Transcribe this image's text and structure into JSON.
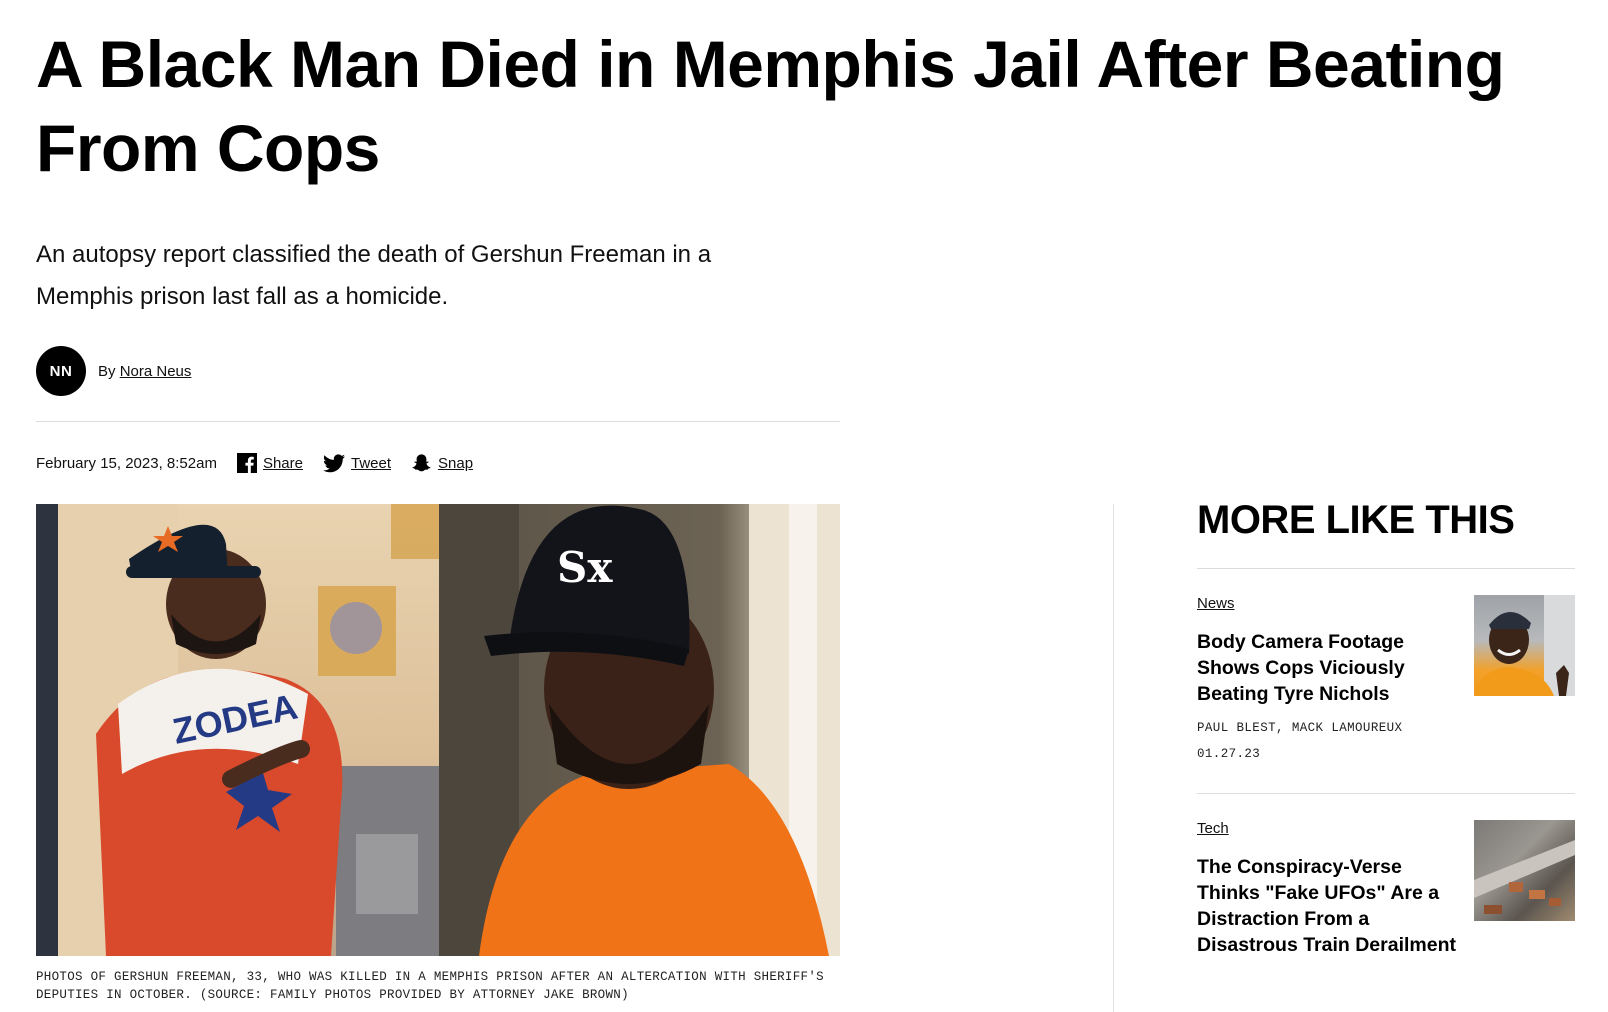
{
  "article": {
    "headline": "A Black Man Died in Memphis Jail After Beating From Cops",
    "dek": "An autopsy report classified the death of Gershun Freeman in a Memphis prison last fall as a homicide.",
    "byline": {
      "initials": "NN",
      "prefix": "By",
      "author": "Nora Neus"
    },
    "date": "February 15, 2023, 8:52am",
    "share": {
      "facebook_label": "Share",
      "twitter_label": "Tweet",
      "snapchat_label": "Snap"
    },
    "caption": "PHOTOS OF GERSHUN FREEMAN, 33, WHO WAS KILLED IN A MEMPHIS PRISON AFTER AN ALTERCATION WITH SHERIFF'S DEPUTIES IN OCTOBER. (SOURCE: FAMILY PHOTOS PROVIDED BY ATTORNEY JAKE BROWN)"
  },
  "more_like_this": {
    "title": "More like this",
    "stories": [
      {
        "category": "News",
        "title": "Body Camera Footage Shows Cops Viciously Beating Tyre Nichols",
        "authors": "PAUL BLEST, MACK LAMOUREUX",
        "date": "01.27.23"
      },
      {
        "category": "Tech",
        "title": "The Conspiracy-Verse Thinks \"Fake UFOs\" Are a Distraction From a Disastrous Train Derailment"
      }
    ]
  },
  "icons": [
    "facebook-icon",
    "twitter-icon",
    "snapchat-icon"
  ],
  "colors": {
    "text": "#000000",
    "rule": "#dcdcdc",
    "avatar_bg": "#000000"
  }
}
